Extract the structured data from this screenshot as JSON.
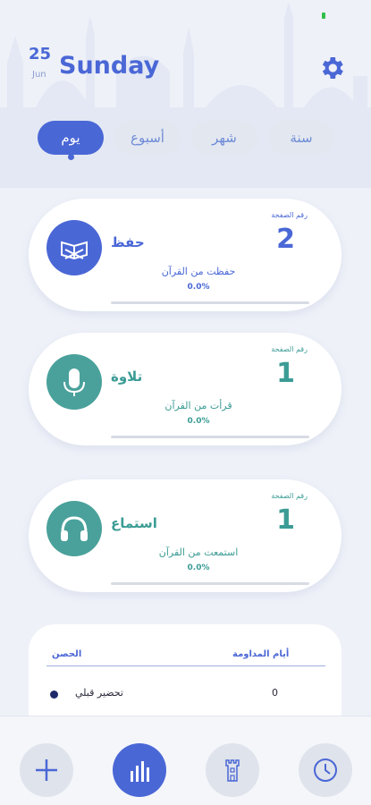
{
  "header": {
    "day_number": "25",
    "month": "Jun",
    "day_name": "Sunday"
  },
  "tabs": [
    {
      "label": "سنة"
    },
    {
      "label": "شهر"
    },
    {
      "label": "أسبوع"
    },
    {
      "label": "يوم"
    }
  ],
  "cards": [
    {
      "title": "حفظ",
      "page_label": "رقم الصفحة",
      "page_number": "2",
      "subtitle": "حفظت من القرآن",
      "percent_text": "0.0%",
      "progress": 0.0,
      "icon": "quran-book-icon"
    },
    {
      "title": "تلاوة",
      "page_label": "رقم الصفحة",
      "page_number": "1",
      "subtitle": "قرأت من القرآن",
      "percent_text": "0.0%",
      "progress": 0.0,
      "icon": "microphone-icon"
    },
    {
      "title": "استماع",
      "page_label": "رقم الصفحة",
      "page_number": "1",
      "subtitle": "استمعت من القرآن",
      "percent_text": "0.0%",
      "progress": 0.0,
      "icon": "headphones-icon"
    }
  ],
  "table": {
    "col_fortress": "الحصن",
    "col_days": "أيام المداومة",
    "rows": [
      {
        "name": "تحضير قبلي",
        "value": "0"
      }
    ]
  },
  "nav": [
    {
      "icon": "plus-icon"
    },
    {
      "icon": "chart-icon"
    },
    {
      "icon": "tower-icon"
    },
    {
      "icon": "clock-icon"
    }
  ],
  "colors": {
    "accent": "#4a67d6",
    "teal": "#4aa19b",
    "background": "#eef1f8"
  }
}
